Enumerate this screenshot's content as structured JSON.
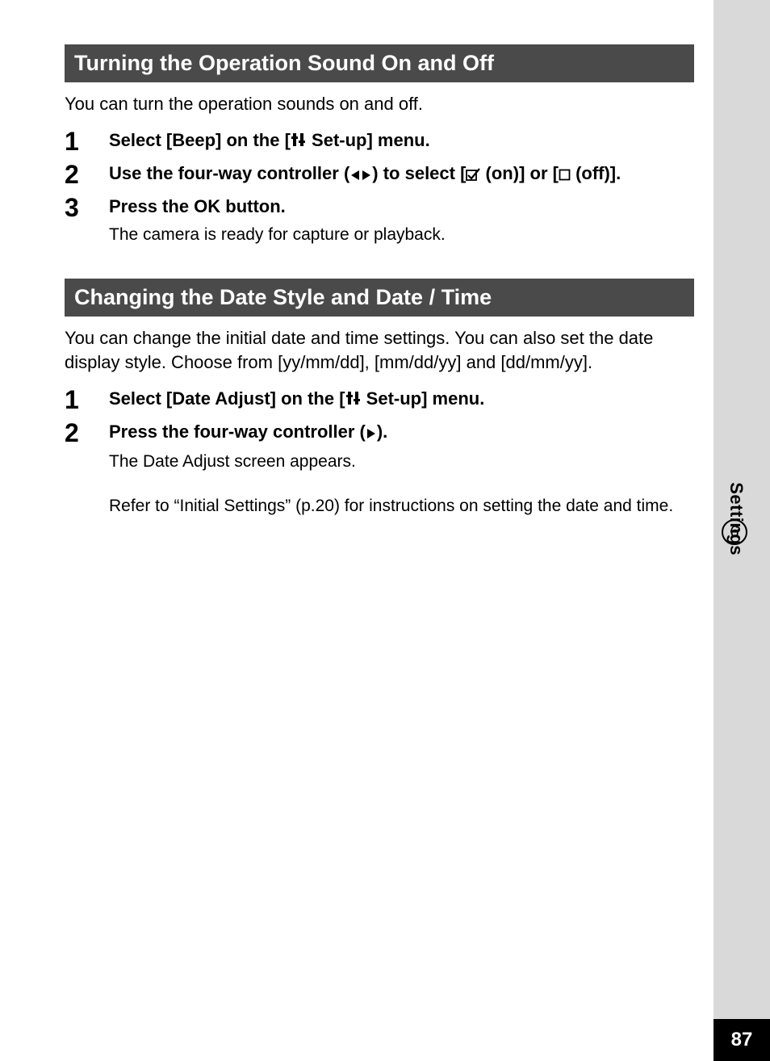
{
  "sidebar": {
    "chapter_number": "6",
    "chapter_label": "Settings"
  },
  "page_number": "87",
  "section1": {
    "title": "Turning the Operation Sound On and Off",
    "intro": "You can turn the operation sounds on and off.",
    "steps": [
      {
        "num": "1",
        "title_pre": "Select [Beep] on the [",
        "title_post": " Set-up] menu."
      },
      {
        "num": "2",
        "title_pre": "Use the four-way controller (",
        "title_mid": ") to select [",
        "title_mid2": " (on)] or [",
        "title_post": " (off)]."
      },
      {
        "num": "3",
        "title": "Press the OK button.",
        "desc": "The camera is ready for capture or playback."
      }
    ]
  },
  "section2": {
    "title": "Changing the Date Style and Date / Time",
    "intro": "You can change the initial date and time settings. You can also set the date display style. Choose from [yy/mm/dd], [mm/dd/yy] and [dd/mm/yy].",
    "steps": [
      {
        "num": "1",
        "title_pre": "Select [Date Adjust] on the [",
        "title_post": " Set-up] menu."
      },
      {
        "num": "2",
        "title_pre": "Press the four-way controller (",
        "title_post": ").",
        "desc1": "The Date Adjust screen appears.",
        "desc2": "Refer to “Initial Settings” (p.20) for instructions on setting the date and time."
      }
    ]
  }
}
